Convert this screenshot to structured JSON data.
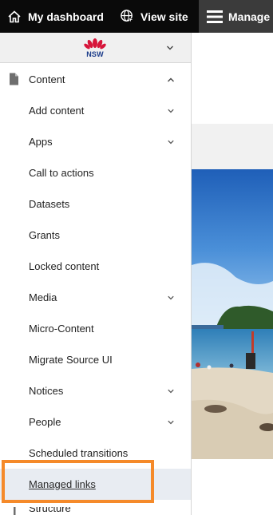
{
  "toolbar": {
    "dashboard_label": "My dashboard",
    "viewsite_label": "View site",
    "manage_label": "Manage"
  },
  "logo": {
    "text": "NSW"
  },
  "content": {
    "label": "Content"
  },
  "menu_items": [
    {
      "label": "Add content",
      "expandable": true
    },
    {
      "label": "Apps",
      "expandable": true
    },
    {
      "label": "Call to actions",
      "expandable": false
    },
    {
      "label": "Datasets",
      "expandable": false
    },
    {
      "label": "Grants",
      "expandable": false
    },
    {
      "label": "Locked content",
      "expandable": false
    },
    {
      "label": "Media",
      "expandable": true
    },
    {
      "label": "Micro-Content",
      "expandable": false
    },
    {
      "label": "Migrate Source UI",
      "expandable": false
    },
    {
      "label": "Notices",
      "expandable": true
    },
    {
      "label": "People",
      "expandable": true
    },
    {
      "label": "Scheduled transitions",
      "expandable": false
    },
    {
      "label": "Managed links",
      "expandable": false,
      "active": true
    }
  ],
  "structure": {
    "label": "Structure"
  },
  "colors": {
    "toolbar": "#0a0a0a",
    "manage_bg": "#3b3b3b",
    "highlight": "#f58a2a",
    "active_row": "#e8ecf2"
  }
}
